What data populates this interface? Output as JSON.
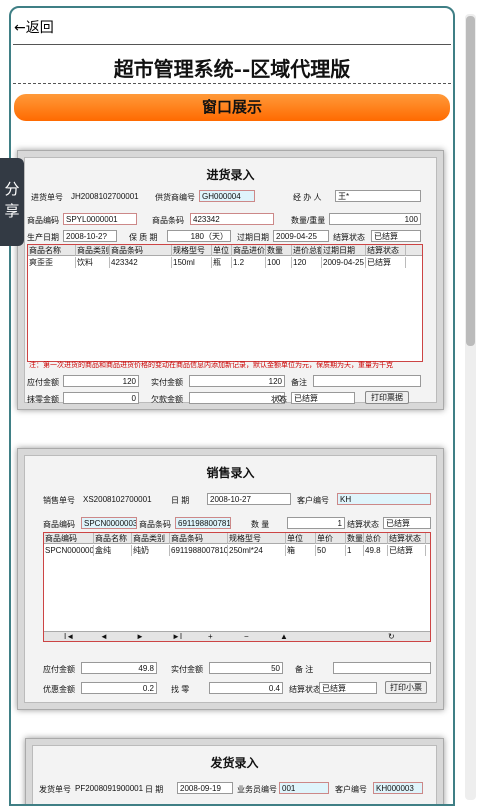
{
  "back": "←返回",
  "title": "超市管理系统--区域代理版",
  "banner": "窗口展示",
  "share": [
    "分",
    "享"
  ],
  "s1": {
    "title": "进货录入",
    "l_no": "进货单号",
    "no": "JH2008102700001",
    "l_sup": "供货商编号",
    "sup": "GH000004",
    "l_op": "经 办 人",
    "op": "王*",
    "l_code": "商品编码",
    "code": "SPYL0000001",
    "l_bar": "商品条码",
    "bar": "423342",
    "l_qty": "数量/重量",
    "qty": "100",
    "l_pd": "生产日期",
    "pd": "2008-10-2?",
    "l_sh": "保 质 期",
    "sh": "180（天）",
    "l_exp": "过期日期",
    "exp": "2009-04-25",
    "l_st": "结算状态",
    "st": "已结算",
    "cols": [
      "商品名称",
      "商品类别",
      "商品条码",
      "规格型号",
      "单位",
      "商品进价",
      "数量",
      "进价总额",
      "过期日期",
      "结算状态"
    ],
    "row": [
      "爽歪歪",
      "饮料",
      "423342",
      "150ml",
      "瓶",
      "1.2",
      "100",
      "120",
      "2009-04-25",
      "已结算"
    ],
    "note": "注：第一次进货的商品和商品进货价格的变动在商品信息内添加新记录，默认金额单位为元，保质期为天，重量为千克",
    "l_pay": "应付金额",
    "pay": "120",
    "l_real": "实付金额",
    "real": "120",
    "l_mark": "备注",
    "l_zero": "抹零金额",
    "zero": "0",
    "l_owe": "欠款金额",
    "owe": "0",
    "l_stat": "状态",
    "stat": "已结算",
    "print": "打印票据"
  },
  "s2": {
    "title": "销售录入",
    "l_no": "销售单号",
    "no": "XS2008102700001",
    "l_date": "日 期",
    "date": "2008-10-27",
    "l_cus": "客户编号",
    "cus": "KH",
    "l_code": "商品编码",
    "code": "SPCN0000003",
    "l_bar": "商品条码",
    "bar": "6911988007810",
    "l_qty": "数 量",
    "qty": "1",
    "l_st": "结算状态",
    "st": "已结算",
    "cols": [
      "商品编码",
      "商品名称",
      "商品类别",
      "商品条码",
      "规格型号",
      "单位",
      "单价",
      "数量",
      "总价",
      "结算状态"
    ],
    "row": [
      "SPCN0000003",
      "盒纯",
      "纯奶",
      "6911988007810",
      "250ml*24",
      "箱",
      "50",
      "1",
      "49.8",
      "已结算"
    ],
    "nav": [
      "I◄",
      "◄",
      "►",
      "►I",
      "+",
      "−",
      "▲",
      "",
      "",
      "↻"
    ],
    "l_pay": "应付金额",
    "pay": "49.8",
    "l_real": "实付金额",
    "real": "50",
    "l_mark": "备 注",
    "l_disc": "优惠金额",
    "disc": "0.2",
    "l_chg": "找 零",
    "chg": "0.4",
    "l_st2": "结算状态",
    "st2": "已结算",
    "print": "打印小票"
  },
  "s3": {
    "title": "发货录入",
    "l_no": "发货单号",
    "no": "PF2008091900001",
    "l_date": "日 期",
    "date": "2008-09-19",
    "l_emp": "业务员编号",
    "emp": "001",
    "l_cus": "客户编号",
    "cus": "KH000003"
  }
}
